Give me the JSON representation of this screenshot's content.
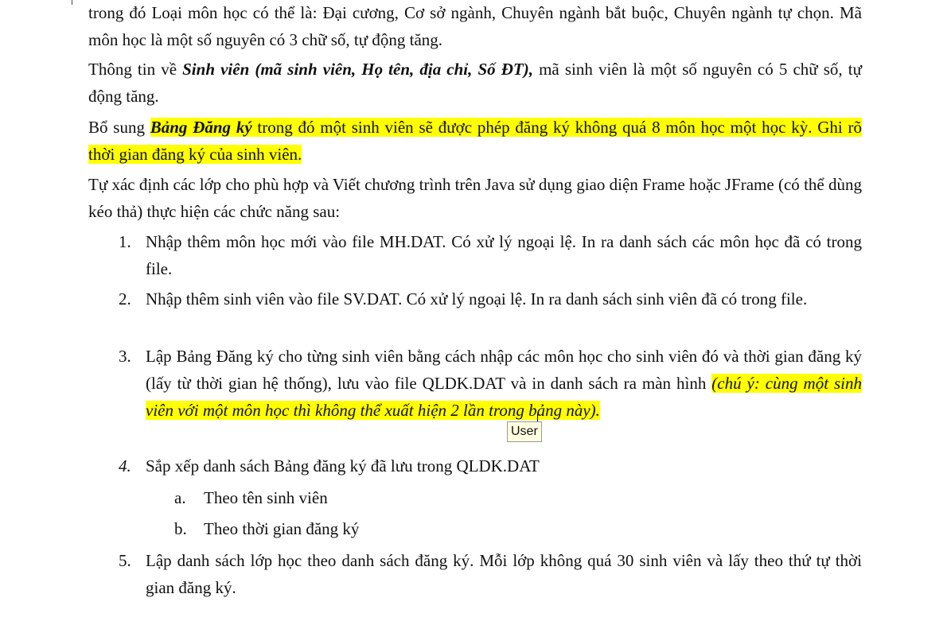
{
  "document": {
    "para_top": {
      "line": "trong đó Loại môn học có thể là: Đại cương, Cơ sở ngành, Chuyên ngành bắt buộc, Chuyên ngành tự chọn.  Mã môn học là một số nguyên có 3 chữ số,  tự động tăng."
    },
    "para_sv": {
      "before": "Thông tin về ",
      "bold_italic": "Sinh viên (mã sinh viên, Họ tên, địa chỉ, Số ĐT),",
      "after": " mã sinh viên là một số nguyên có 5 chữ số,  tự động tăng."
    },
    "para_bdk": {
      "before": "Bổ sung ",
      "bold_italic": "Bảng Đăng ký",
      "highlighted": " trong đó một sinh viên sẽ được phép đăng ký không quá 8 môn học một học kỳ. Ghi rõ thời gian đăng ký của sinh viên."
    },
    "para_task": {
      "text": "Tự xác định các lớp cho phù hợp và Viết chương trình trên Java sử dụng giao diện Frame hoặc JFrame (có thể dùng kéo thả) thực hiện các chức năng sau:"
    },
    "list": [
      {
        "num": "1.",
        "text": "Nhập thêm môn học mới vào file MH.DAT. Có xử lý ngoại lệ. In ra danh sách các môn học đã có trong file."
      },
      {
        "num": "2.",
        "text": "Nhập thêm sinh viên vào file SV.DAT. Có xử lý ngoại lệ.  In ra danh sách sinh viên đã có trong file."
      },
      {
        "num": "3.",
        "text": "Lập Bảng Đăng ký cho từng sinh viên bằng cách nhập các môn học cho sinh viên đó và thời gian đăng ký (lấy từ thời gian hệ thống), lưu vào file QLDK.DAT và in danh sách ra màn hình ",
        "note": "(chú ý: cùng một sinh viên với một môn học thì không thể xuất hiện 2 lần trong bảng này)."
      },
      {
        "num": "4.",
        "text": "Sắp xếp danh sách Bảng đăng ký đã lưu trong QLDK.DAT"
      },
      {
        "num": "5.",
        "text": "Lập danh sách lớp học theo danh sách đăng ký. Mỗi lớp không quá 30 sinh viên và lấy theo thứ tự thời gian đăng ký."
      }
    ],
    "sublist": [
      {
        "num": "a.",
        "text": "Theo tên sinh viên"
      },
      {
        "num": "b.",
        "text": "Theo thời gian đăng ký"
      }
    ],
    "comment_label": "User"
  },
  "colors": {
    "highlight": "#ffff00",
    "text": "#111111",
    "comment_bg": "#fffde0"
  }
}
